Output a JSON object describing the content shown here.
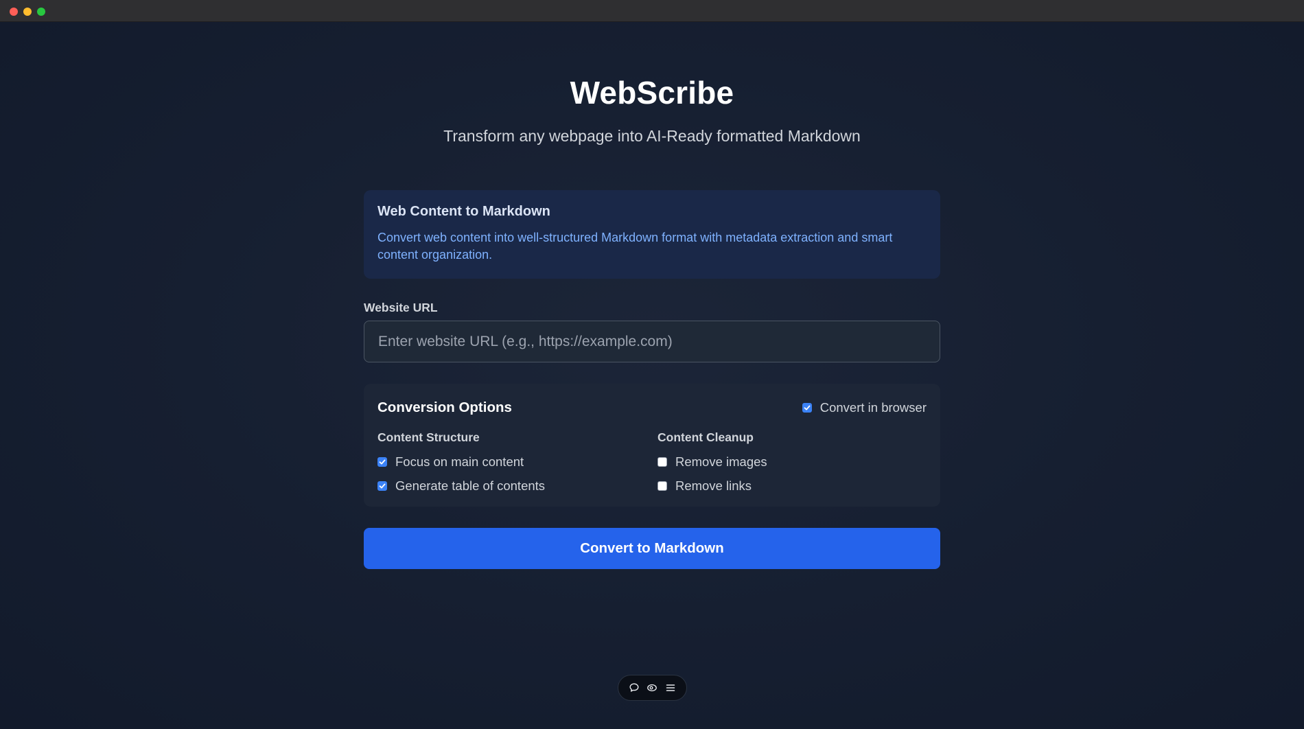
{
  "window": {
    "controls": [
      "close",
      "minimize",
      "maximize"
    ]
  },
  "header": {
    "title": "WebScribe",
    "subtitle": "Transform any webpage into AI-Ready formatted Markdown"
  },
  "info_card": {
    "title": "Web Content to Markdown",
    "description": "Convert web content into well-structured Markdown format with metadata extraction and smart content organization."
  },
  "url_field": {
    "label": "Website URL",
    "value": "",
    "placeholder": "Enter website URL (e.g., https://example.com)"
  },
  "options": {
    "title": "Conversion Options",
    "convert_in_browser": {
      "label": "Convert in browser",
      "checked": true
    },
    "content_structure": {
      "title": "Content Structure",
      "items": [
        {
          "label": "Focus on main content",
          "checked": true
        },
        {
          "label": "Generate table of contents",
          "checked": true
        }
      ]
    },
    "content_cleanup": {
      "title": "Content Cleanup",
      "items": [
        {
          "label": "Remove images",
          "checked": false
        },
        {
          "label": "Remove links",
          "checked": false
        }
      ]
    }
  },
  "convert_button": {
    "label": "Convert to Markdown"
  },
  "floating_toolbar": {
    "icons": [
      "chat-bubble-icon",
      "eye-icon",
      "menu-icon"
    ]
  },
  "colors": {
    "accent": "#2563eb",
    "checkbox_checked": "#3b82f6",
    "info_text": "#7fb2ff",
    "background": "#161f31"
  }
}
